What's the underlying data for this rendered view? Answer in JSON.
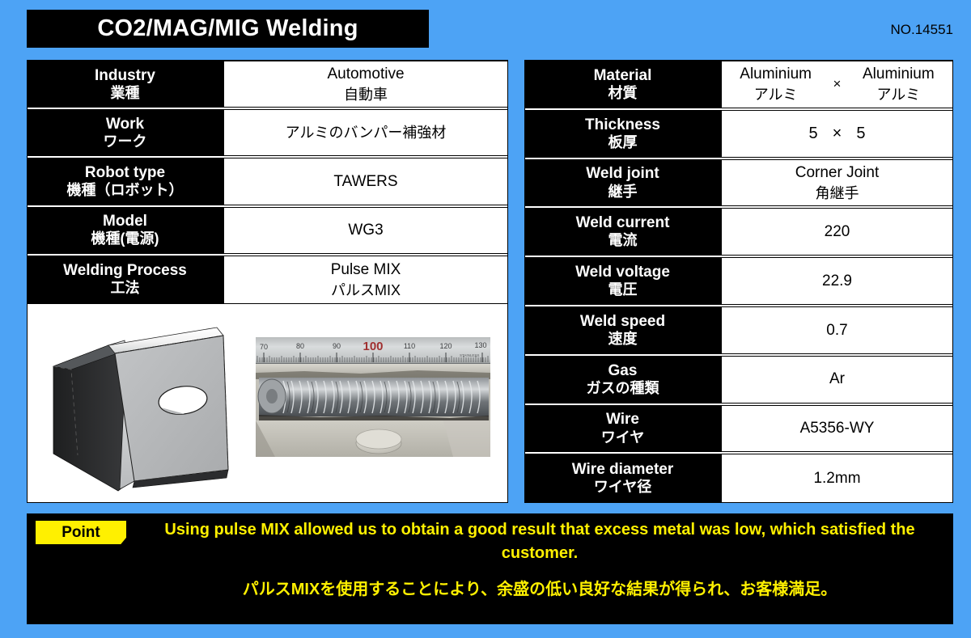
{
  "header": {
    "title": "CO2/MAG/MIG Welding",
    "doc_number": "NO.14551",
    "accent_blue": "#4DA3F5",
    "panel_black": "#000000",
    "highlight_yellow": "#FFF000"
  },
  "left_table": {
    "rows": [
      {
        "label_en": "Industry",
        "label_jp": "業種",
        "value_en": "Automotive",
        "value_jp": "自動車"
      },
      {
        "label_en": "Work",
        "label_jp": "ワーク",
        "value_en": "",
        "value_jp": "アルミのバンパー補強材"
      },
      {
        "label_en": "Robot type",
        "label_jp": "機種（ロボット）",
        "value_en": "TAWERS",
        "value_jp": ""
      },
      {
        "label_en": "Model",
        "label_jp": "機種(電源)",
        "value_en": "WG3",
        "value_jp": ""
      },
      {
        "label_en": "Welding Process",
        "label_jp": "工法",
        "value_en": "Pulse MIX",
        "value_jp": "パルスMIX"
      }
    ]
  },
  "images": {
    "cad_caption": "3d-cad-bumper-reinforcement",
    "photo_caption": "weld-bead-macro-photo",
    "ruler_marks": [
      "70",
      "80",
      "90",
      "100",
      "110",
      "120",
      "130"
    ],
    "ruler_highlight": "100",
    "ruler_brand": "STAINLESS"
  },
  "right_table": {
    "material": {
      "label_en": "Material",
      "label_jp": "材質",
      "left_en": "Aluminium",
      "left_jp": "アルミ",
      "separator": "×",
      "right_en": "Aluminium",
      "right_jp": "アルミ"
    },
    "thickness": {
      "label_en": "Thickness",
      "label_jp": "板厚",
      "left": "5",
      "separator": "×",
      "right": "5"
    },
    "rows": [
      {
        "label_en": "Weld joint",
        "label_jp": "継手",
        "value_en": "Corner Joint",
        "value_jp": "角継手"
      },
      {
        "label_en": "Weld current",
        "label_jp": "電流",
        "value_en": "220",
        "value_jp": ""
      },
      {
        "label_en": "Weld voltage",
        "label_jp": "電圧",
        "value_en": "22.9",
        "value_jp": ""
      },
      {
        "label_en": "Weld speed",
        "label_jp": "速度",
        "value_en": "0.7",
        "value_jp": ""
      },
      {
        "label_en": "Gas",
        "label_jp": "ガスの種類",
        "value_en": "Ar",
        "value_jp": ""
      },
      {
        "label_en": "Wire",
        "label_jp": "ワイヤ",
        "value_en": "A5356-WY",
        "value_jp": ""
      },
      {
        "label_en": "Wire diameter",
        "label_jp": "ワイヤ径",
        "value_en": "1.2mm",
        "value_jp": ""
      }
    ]
  },
  "point": {
    "badge": "Point",
    "text_en": "Using pulse MIX allowed us to obtain a good result that excess metal was low, which satisfied  the customer.",
    "text_jp": "パルスMIXを使用することにより、余盛の低い良好な結果が得られ、お客様満足。"
  }
}
